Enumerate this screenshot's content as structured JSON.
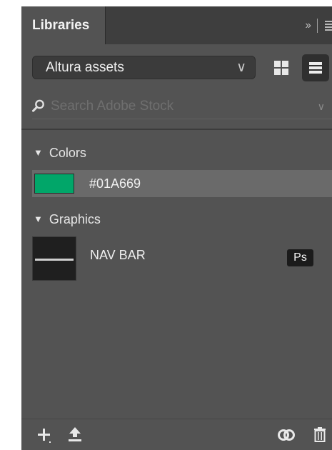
{
  "panel": {
    "tab_label": "Libraries",
    "tab_controls": {
      "collapse_glyph": "››",
      "menu_icon": "hamburger-menu-icon"
    }
  },
  "library_select": {
    "value": "Altura assets",
    "chevron": "∨"
  },
  "view_modes": {
    "grid": "grid-view-icon",
    "list": "list-view-icon",
    "active": "list"
  },
  "search": {
    "placeholder": "Search Adobe Stock",
    "value": "",
    "chevron": "∨"
  },
  "sections": {
    "colors": {
      "title": "Colors",
      "items": [
        {
          "label": "#01A669",
          "swatch": "#01A669"
        }
      ]
    },
    "graphics": {
      "title": "Graphics",
      "items": [
        {
          "label": "NAV BAR",
          "app_badge": "Ps"
        }
      ]
    }
  },
  "footer": {
    "icons": [
      "add-icon",
      "upload-icon",
      "creative-cloud-sync-icon",
      "trash-icon"
    ]
  },
  "colors": {
    "panel_bg": "#535353",
    "tabbar_bg": "#3e3e3e",
    "selected_row": "#6a6a6a"
  }
}
